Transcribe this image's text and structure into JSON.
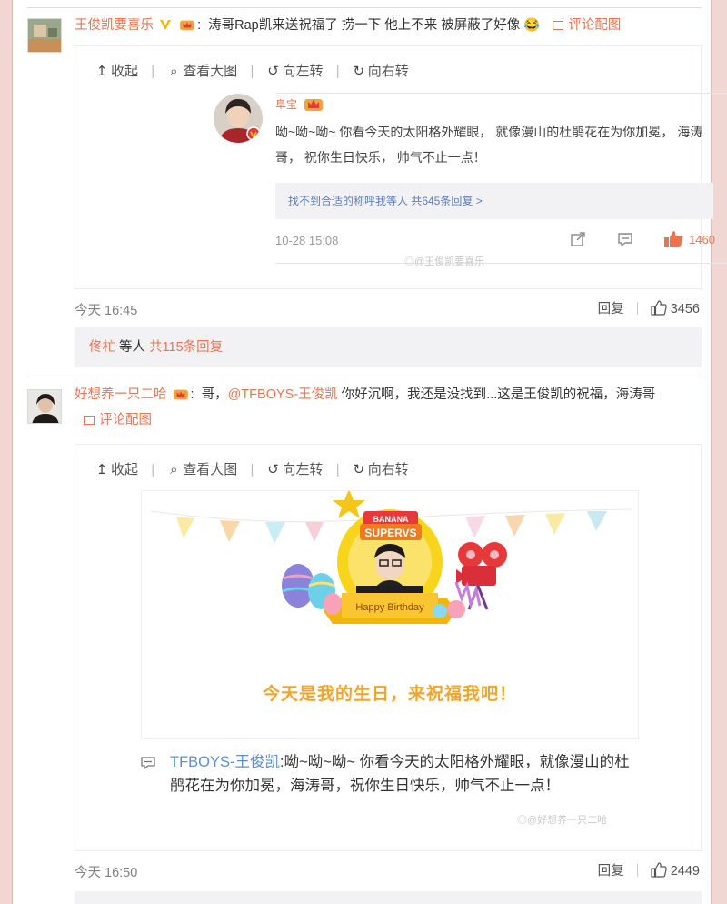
{
  "comments": [
    {
      "username": "王俊凯要喜乐",
      "colon": ":",
      "text": "涛哥Rap凯来送祝福了 捞一下 他上不来 被屏蔽了好像",
      "emoji": "😂",
      "pic_link": "评论配图",
      "toolbar": {
        "collapse": "收起",
        "view_large": "查看大图",
        "rotate_left": "向左转",
        "rotate_right": "向右转"
      },
      "image": {
        "name": "阜宝",
        "body": "呦~呦~呦~ 你看今天的太阳格外耀眼， 就像漫山的杜鹃花在为你加冕， 海涛哥， 祝你生日快乐， 帅气不止一点！",
        "reply_link": "找不到合适的称呼我等人 共645条回复 >",
        "time": "10-28 15:08",
        "likes": "1460",
        "watermark": "@王俊凯要喜乐"
      },
      "time": "今天 16:45",
      "reply_label": "回复",
      "like_count": "3456",
      "replies": {
        "user": "佟杧",
        "middle": "等人",
        "count_text": "共115条回复"
      }
    },
    {
      "username": "好想养一只二哈",
      "colon": ":",
      "text_before": "哥，",
      "mention": "@TFBOYS-王俊凯",
      "text_after": " 你好沉啊，我还是没找到...这是王俊凯的祝福，海涛哥",
      "pic_link": "评论配图",
      "toolbar": {
        "collapse": "收起",
        "view_large": "查看大图",
        "rotate_left": "向左转",
        "rotate_right": "向右转"
      },
      "image": {
        "banner_text": "BANANA SUPERVS",
        "ribbon": "Happy Birthday",
        "card_title": "今天是我的生日，来祝福我吧！",
        "author": "TFBOYS-王俊凯",
        "message": ":呦~呦~呦~ 你看今天的太阳格外耀眼，就像漫山的杜鹃花在为你加冕，海涛哥，祝你生日快乐，帅气不止一点！",
        "watermark": "@好想养一只二哈"
      },
      "time": "今天 16:50",
      "reply_label": "回复",
      "like_count": "2449"
    }
  ],
  "colors": {
    "accent": "#eb7350",
    "link_blue": "#5b8fc9",
    "reply_bg": "#f2f2f5",
    "side_bar": "#f1d7d4"
  }
}
